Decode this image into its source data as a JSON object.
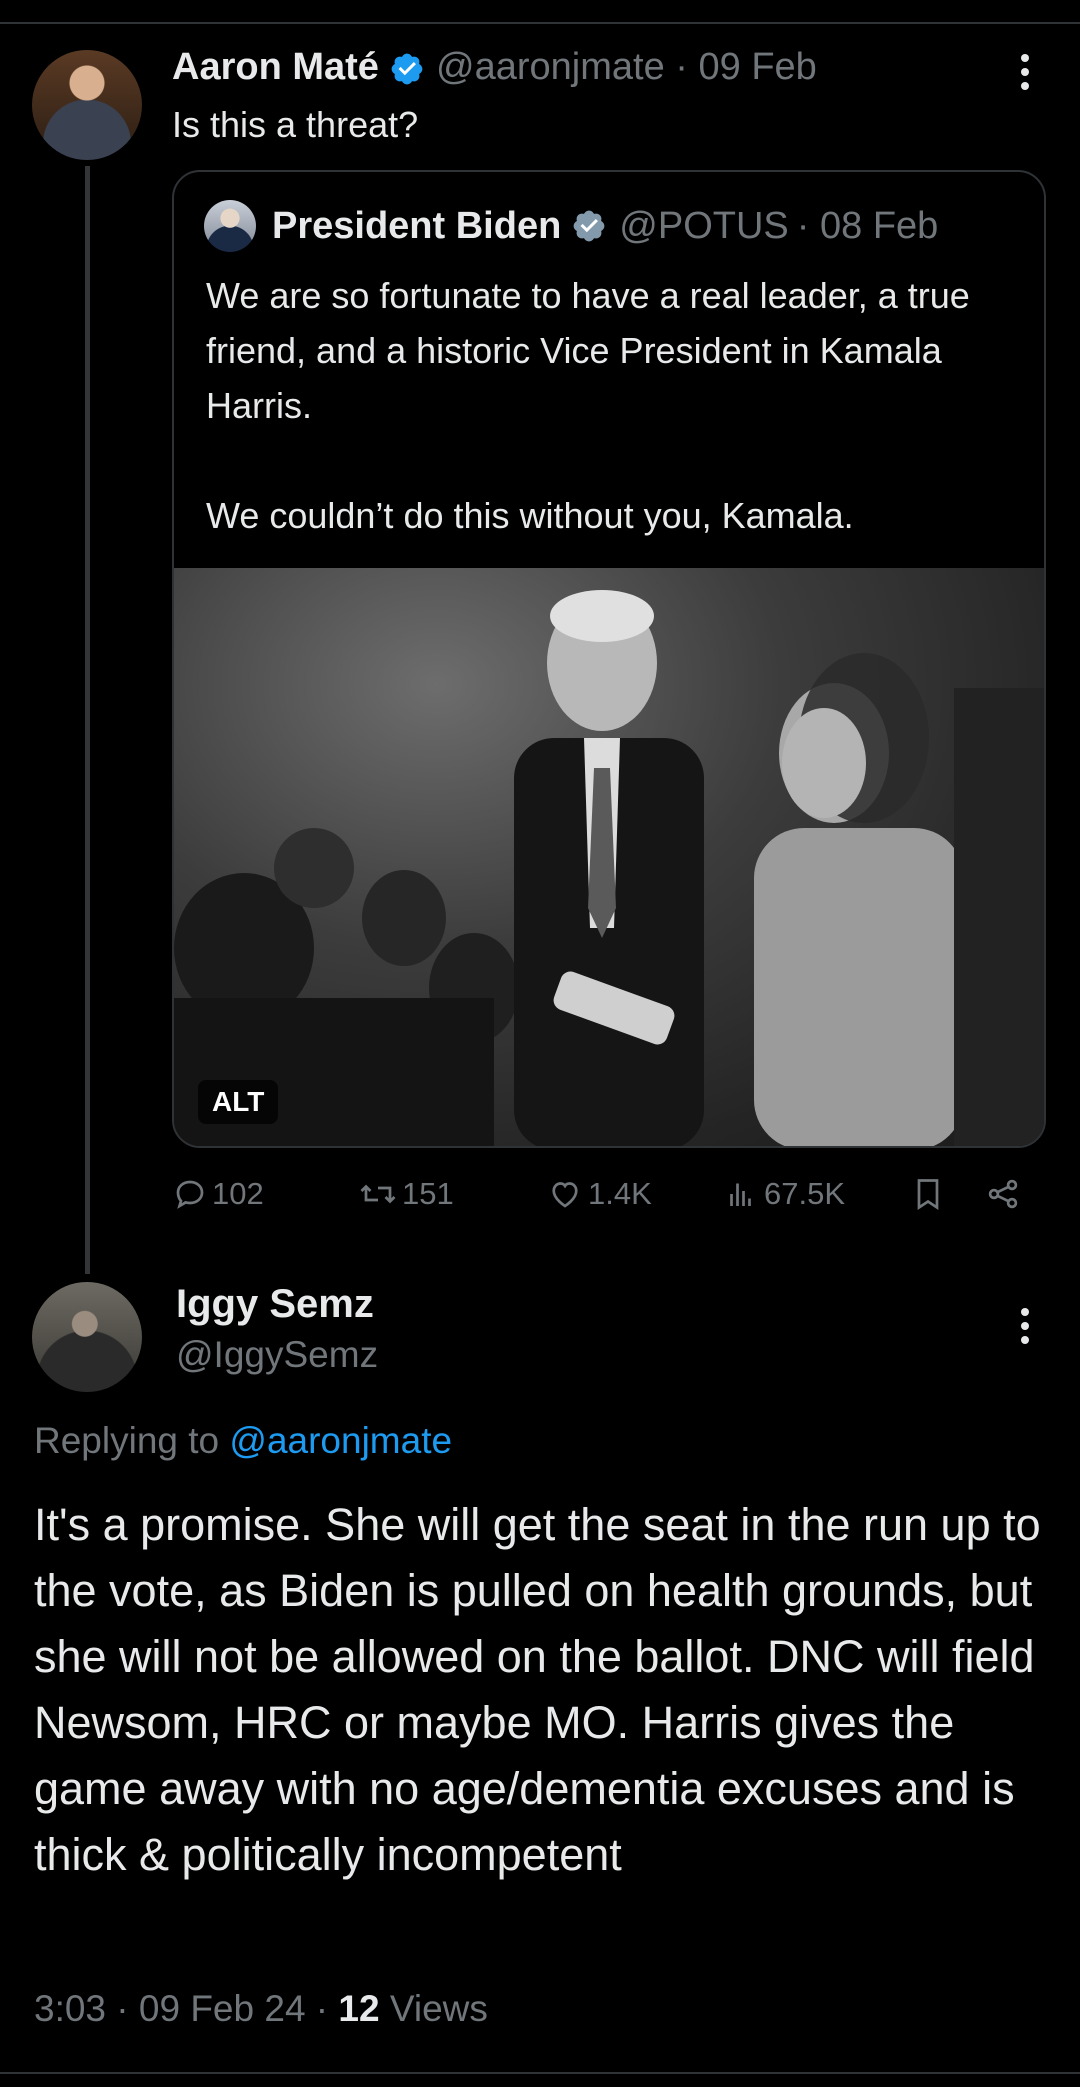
{
  "parent_tweet": {
    "display_name": "Aaron Maté",
    "handle": "@aaronjmate",
    "date": "· 09 Feb",
    "text": "Is this a threat?",
    "quoted": {
      "display_name": "President Biden",
      "handle": "@POTUS",
      "date": "· 08 Feb",
      "paragraphs": [
        "We are so fortunate to have a real leader, a true friend, and a historic Vice President in Kamala Harris.",
        "We couldn’t do this without you, Kamala."
      ],
      "alt_badge": "ALT"
    },
    "actions": {
      "replies": "102",
      "reposts": "151",
      "likes": "1.4K",
      "views": "67.5K"
    }
  },
  "reply": {
    "display_name": "Iggy Semz",
    "handle": "@IggySemz",
    "replying_prefix": "Replying to ",
    "replying_to": "@aaronjmate",
    "text": "It's a promise. She will get the seat in the run up to the vote, as Biden is pulled on health grounds, but she will not be allowed on the ballot. DNC will field Newsom, HRC or maybe MO. Harris gives the game away with no age/dementia excuses and is thick & politically incompetent",
    "time": "3:03 · 09 Feb 24 · ",
    "views_count": "12",
    "views_label": " Views"
  },
  "colors": {
    "background": "#000000",
    "text": "#e7e9ea",
    "muted": "#71767b",
    "link": "#1d9bf0",
    "verified": "#1d9bf0",
    "divider": "#2f3336"
  },
  "icons": [
    "verified-badge-icon",
    "more-icon",
    "reply-icon",
    "repost-icon",
    "like-icon",
    "views-icon",
    "bookmark-icon",
    "share-icon"
  ]
}
